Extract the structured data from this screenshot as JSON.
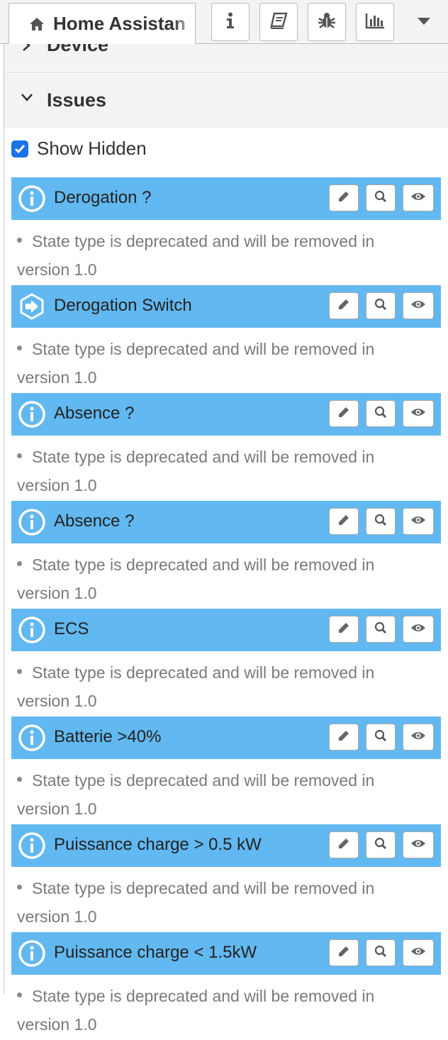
{
  "tab": {
    "title": "Home Assistan",
    "icon": "home-icon"
  },
  "toolbar": {
    "buttons": [
      {
        "name": "info-button",
        "icon": "info-icon"
      },
      {
        "name": "book-button",
        "icon": "book-icon"
      },
      {
        "name": "debug-button",
        "icon": "bug-icon"
      },
      {
        "name": "chart-button",
        "icon": "bar-chart-icon"
      }
    ],
    "dropdown_icon": "caret-down-icon"
  },
  "sections": {
    "device": "Device",
    "issues": "Issues"
  },
  "show_hidden": {
    "label": "Show Hidden",
    "checked": true
  },
  "issues": [
    {
      "title": "Derogation ?",
      "icon": "info-circle-icon",
      "message": "State type is deprecated and will be removed in version 1.0"
    },
    {
      "title": "Derogation Switch",
      "icon": "switch-hexagon-icon",
      "message": "State type is deprecated and will be removed in version 1.0"
    },
    {
      "title": "Absence ?",
      "icon": "info-circle-icon",
      "message": "State type is deprecated and will be removed in version 1.0"
    },
    {
      "title": "Absence ?",
      "icon": "info-circle-icon",
      "message": "State type is deprecated and will be removed in version 1.0"
    },
    {
      "title": "ECS",
      "icon": "info-circle-icon",
      "message": "State type is deprecated and will be removed in version 1.0"
    },
    {
      "title": "Batterie >40%",
      "icon": "info-circle-icon",
      "message": "State type is deprecated and will be removed in version 1.0"
    },
    {
      "title": "Puissance charge > 0.5 kW",
      "icon": "info-circle-icon",
      "message": "State type is deprecated and will be removed in version 1.0"
    },
    {
      "title": "Puissance charge < 1.5kW",
      "icon": "info-circle-icon",
      "message": "State type is deprecated and will be removed in version 1.0"
    }
  ],
  "colors": {
    "issue_bar": "#62b8f0",
    "checkbox": "#1a73e8"
  }
}
